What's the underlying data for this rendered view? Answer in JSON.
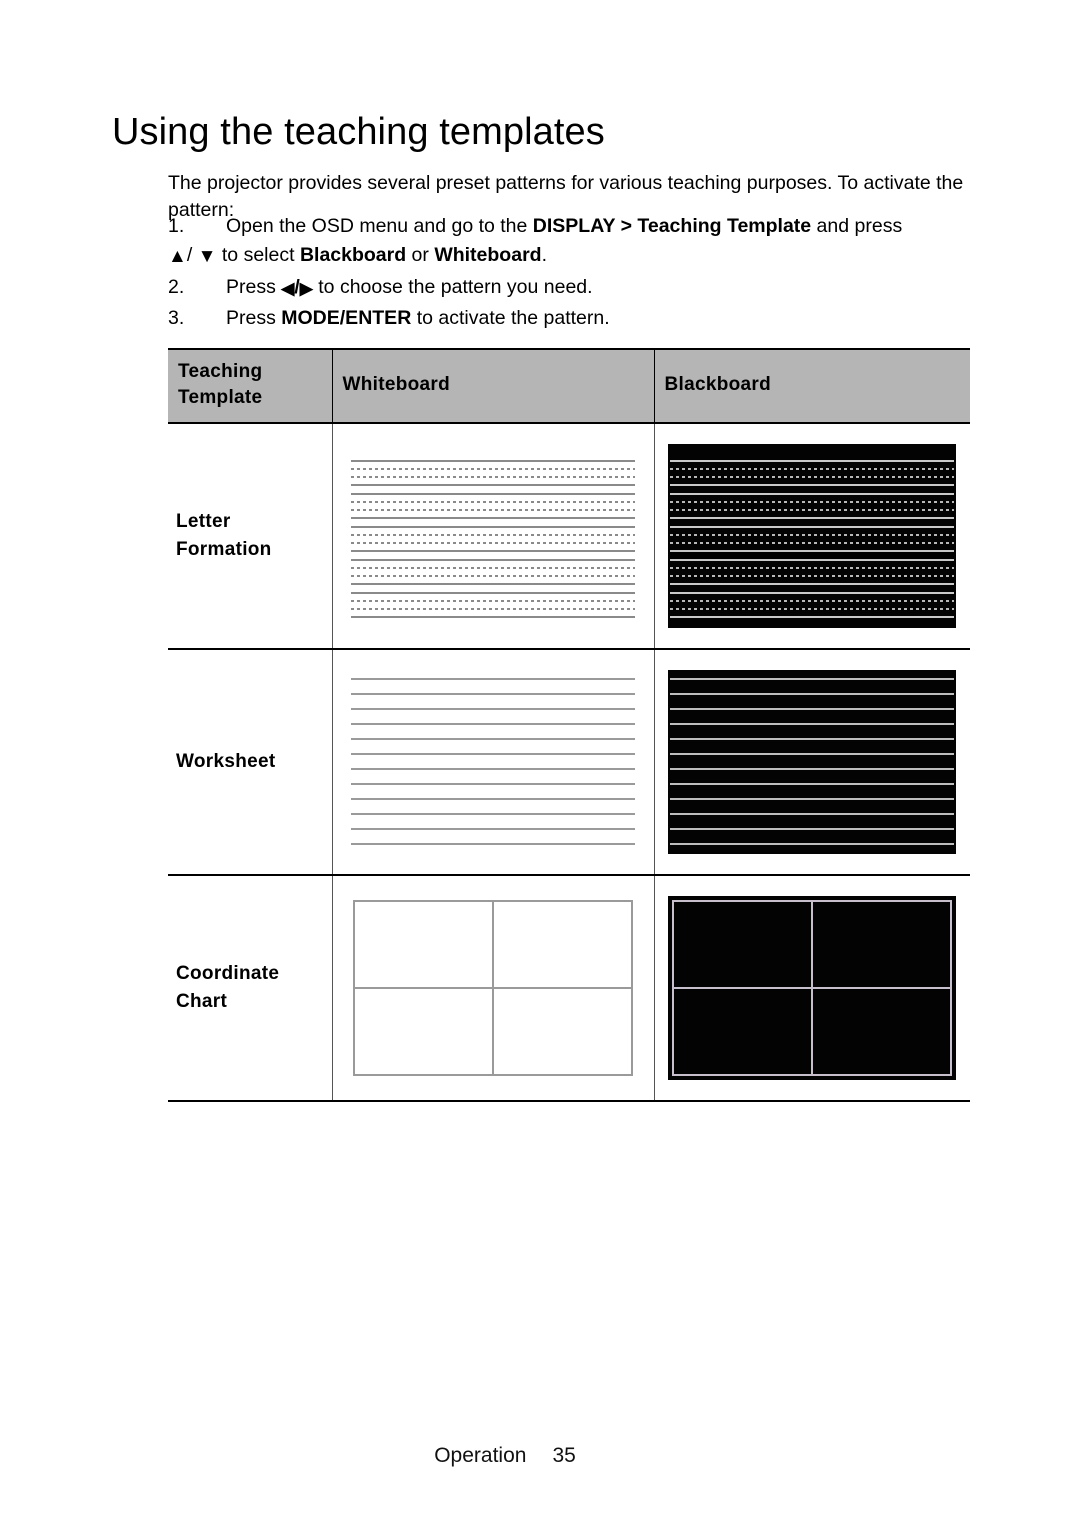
{
  "page": {
    "title": "Using the teaching templates",
    "intro": "The projector provides several preset patterns for various teaching purposes. To activate the pattern:"
  },
  "steps": [
    {
      "number": "1.",
      "line1_pre": "Open the OSD menu and go to the ",
      "line1_bold1": "DISPLAY",
      "line1_mid": " > ",
      "line1_bold2": "Teaching Template",
      "line1_post": " and press",
      "line2_arrow_up": "▲",
      "line2_slash": "/ ",
      "line2_arrow_down": "▼",
      "line2_mid": " to select ",
      "line2_bold1": "Blackboard",
      "line2_or": " or ",
      "line2_bold2": "Whiteboard",
      "line2_end": "."
    },
    {
      "number": "2.",
      "pre": "Press ",
      "arrow_left": "◀",
      "slash": "/",
      "arrow_right": "▶",
      "post": " to choose the pattern you need."
    },
    {
      "number": "3.",
      "pre": "Press ",
      "bold": "MODE/ENTER",
      "post": " to activate the pattern."
    }
  ],
  "table": {
    "headers": {
      "col1_line1": "Teaching",
      "col1_line2": "Template",
      "col2": "Whiteboard",
      "col3": "Blackboard"
    },
    "rows": [
      {
        "label_line1": "Letter",
        "label_line2": "Formation",
        "pattern": "letter-formation",
        "whiteboard_desc": "five handwriting ruling groups, solid guide lines with two dashed midlines, dark lines on white",
        "blackboard_desc": "five handwriting ruling groups, solid guide lines with two dashed midlines, light lines on black"
      },
      {
        "label_line1": "Worksheet",
        "label_line2": "",
        "pattern": "worksheet",
        "whiteboard_desc": "twelve evenly spaced horizontal ruled lines, gray on white",
        "blackboard_desc": "twelve evenly spaced horizontal ruled lines, light gray on black"
      },
      {
        "label_line1": "Coordinate",
        "label_line2": "Chart",
        "pattern": "coordinate-chart",
        "whiteboard_desc": "rectangular frame divided into four quadrants by one vertical and one horizontal axis, gray on white",
        "blackboard_desc": "rectangular frame divided into four quadrants by one vertical and one horizontal axis, light lines on black"
      }
    ],
    "pattern_specs": {
      "letter_formation_groups": 5,
      "worksheet_lines": 12,
      "coordinate_quadrants": 4
    }
  },
  "footer": {
    "section": "Operation",
    "page_number": "35"
  },
  "colors": {
    "header_fill": "#b5b5b5",
    "blackboard_fill": "#030303",
    "whiteboard_fill": "#ffffff",
    "rule_gray": "#8a8a8a",
    "rule_light": "#c9c9c9",
    "text": "#000000"
  }
}
